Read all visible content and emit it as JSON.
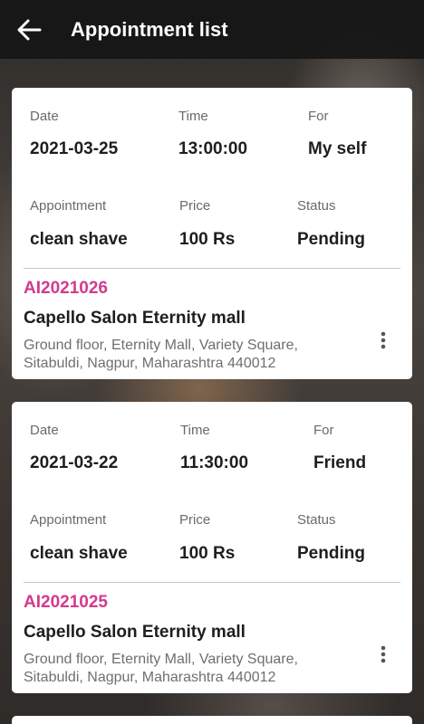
{
  "header": {
    "title": "Appointment list",
    "back_icon": "arrow-left-icon"
  },
  "appointments": [
    {
      "date_label": "Date",
      "date": "2021-03-25",
      "time_label": "Time",
      "time": "13:00:00",
      "for_label": "For",
      "for": "My self",
      "appointment_label": "Appointment",
      "appointment": "clean shave",
      "price_label": "Price",
      "price": "100 Rs",
      "status_label": "Status",
      "status": "Pending",
      "id": "AI2021026",
      "salon": "Capello Salon Eternity mall",
      "address_line1": "Ground floor, Eternity Mall, Variety Square,",
      "address_line2": "Sitabuldi, Nagpur, Maharashtra 440012"
    },
    {
      "date_label": "Date",
      "date": "2021-03-22",
      "time_label": "Time",
      "time": "11:30:00",
      "for_label": "For",
      "for": "Friend",
      "appointment_label": "Appointment",
      "appointment": "clean shave",
      "price_label": "Price",
      "price": "100 Rs",
      "status_label": "Status",
      "status": "Pending",
      "id": "AI2021025",
      "salon": "Capello Salon Eternity mall",
      "address_line1": "Ground floor, Eternity Mall, Variety Square,",
      "address_line2": "Sitabuldi, Nagpur, Maharashtra 440012"
    }
  ],
  "colors": {
    "accent": "#d43a8c",
    "appbar": "#161616"
  }
}
